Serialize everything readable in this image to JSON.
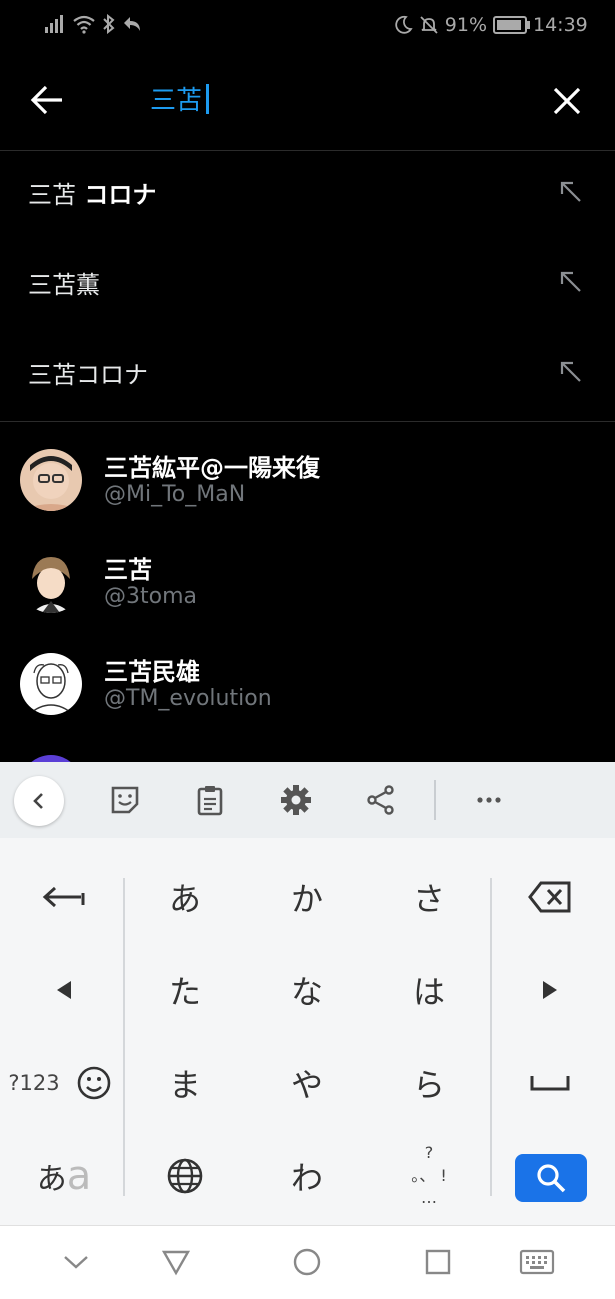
{
  "status": {
    "battery": "91%",
    "battery_level": 0.91,
    "time": "14:39"
  },
  "search": {
    "query": "三苫"
  },
  "suggestions": [
    {
      "prefix": "三苫",
      "bold": " コロナ"
    },
    {
      "prefix": "三苫薫",
      "bold": ""
    },
    {
      "prefix": "三苫コロナ",
      "bold": ""
    }
  ],
  "users": [
    {
      "name": "三苫紘平@一陽来復",
      "handle": "@Mi_To_MaN"
    },
    {
      "name": "三苫",
      "handle": "@3toma"
    },
    {
      "name": "三苫民雄",
      "handle": "@TM_evolution"
    }
  ],
  "keyboard": {
    "rows": [
      [
        "あ",
        "か",
        "さ"
      ],
      [
        "た",
        "な",
        "は"
      ],
      [
        "ま",
        "や",
        "ら"
      ],
      [
        "わ"
      ]
    ],
    "num_key": "?123",
    "kana_key_a": "あ",
    "kana_key_b": "a",
    "punct_top": "?",
    "punct_mid": "。、 !",
    "punct_bottom": "…"
  },
  "icons": {
    "back": "arrow-left-icon",
    "clear": "close-icon",
    "suggestion_fill": "arrow-up-left-icon",
    "search": "search-icon"
  },
  "colors": {
    "accent": "#1d9bf0",
    "keyboard_search": "#1a73e8",
    "handle": "#71767b"
  }
}
